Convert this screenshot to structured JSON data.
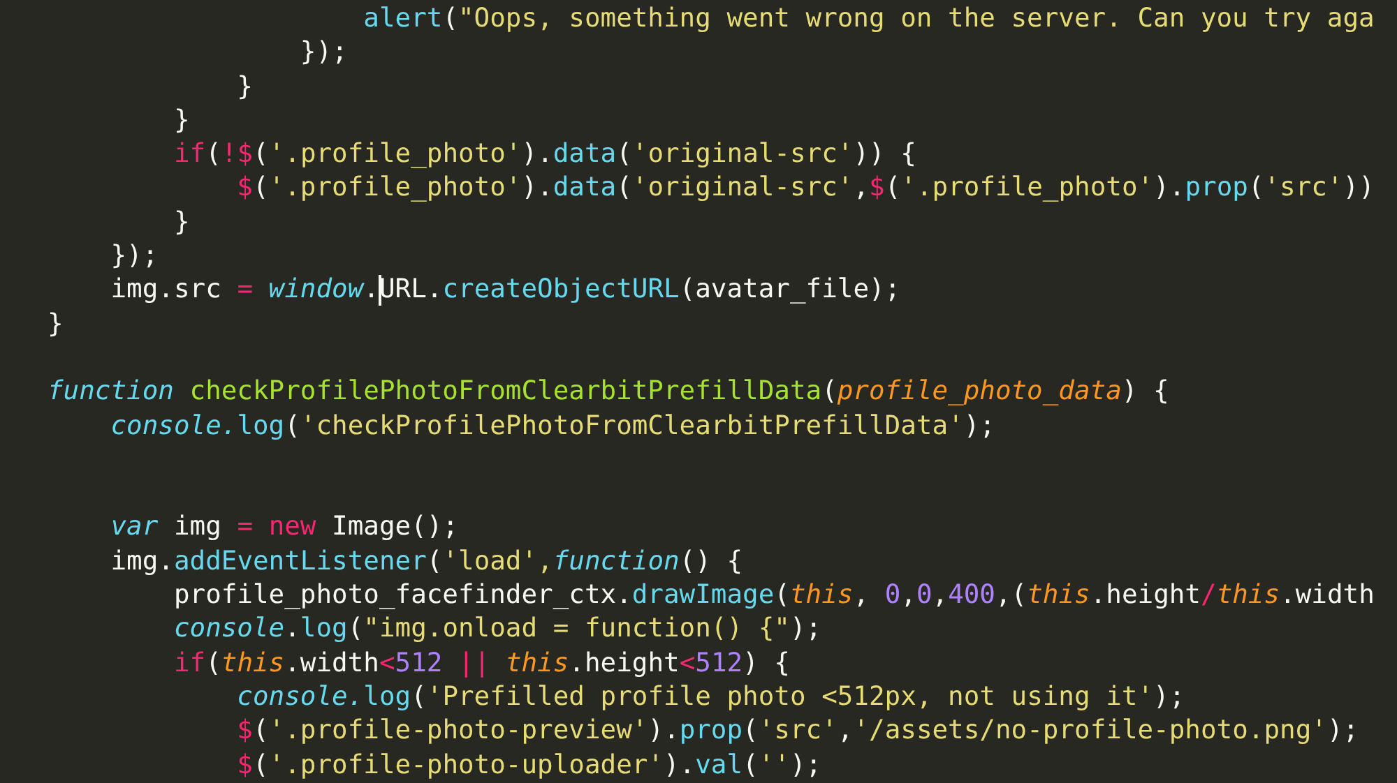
{
  "editor": {
    "lines": [
      {
        "kind": "code",
        "tokens": [
          {
            "kind": "fn",
            "text": "                    alert"
          },
          {
            "kind": "p",
            "text": "("
          },
          {
            "kind": "str",
            "text": "\"Oops, something went wrong on the server. Can you try aga"
          }
        ]
      },
      {
        "kind": "code",
        "tokens": [
          {
            "kind": "p",
            "text": "                });"
          }
        ]
      },
      {
        "kind": "code",
        "tokens": [
          {
            "kind": "p",
            "text": "            }"
          }
        ]
      },
      {
        "kind": "code",
        "tokens": [
          {
            "kind": "p",
            "text": "        }"
          }
        ]
      },
      {
        "kind": "code",
        "tokens": [
          {
            "kind": "kw",
            "text": "        if"
          },
          {
            "kind": "p",
            "text": "("
          },
          {
            "kind": "kw",
            "text": "!$"
          },
          {
            "kind": "p",
            "text": "("
          },
          {
            "kind": "str",
            "text": "'.profile_photo'"
          },
          {
            "kind": "p",
            "text": ")."
          },
          {
            "kind": "fn",
            "text": "data"
          },
          {
            "kind": "p",
            "text": "("
          },
          {
            "kind": "str",
            "text": "'original-src'"
          },
          {
            "kind": "p",
            "text": ")) {"
          }
        ]
      },
      {
        "kind": "code",
        "tokens": [
          {
            "kind": "kw",
            "text": "            $"
          },
          {
            "kind": "p",
            "text": "("
          },
          {
            "kind": "str",
            "text": "'.profile_photo'"
          },
          {
            "kind": "p",
            "text": ")."
          },
          {
            "kind": "fn",
            "text": "data"
          },
          {
            "kind": "p",
            "text": "("
          },
          {
            "kind": "str",
            "text": "'original-src'"
          },
          {
            "kind": "p",
            "text": ","
          },
          {
            "kind": "kw",
            "text": "$"
          },
          {
            "kind": "p",
            "text": "("
          },
          {
            "kind": "str",
            "text": "'.profile_photo'"
          },
          {
            "kind": "p",
            "text": ")."
          },
          {
            "kind": "fn",
            "text": "prop"
          },
          {
            "kind": "p",
            "text": "("
          },
          {
            "kind": "str",
            "text": "'src'"
          },
          {
            "kind": "p",
            "text": "))"
          }
        ]
      },
      {
        "kind": "code",
        "tokens": [
          {
            "kind": "p",
            "text": "        }"
          }
        ]
      },
      {
        "kind": "code",
        "tokens": [
          {
            "kind": "p",
            "text": "    });"
          }
        ]
      },
      {
        "kind": "code",
        "tokens": [
          {
            "kind": "p",
            "text": "    img.src "
          },
          {
            "kind": "kw",
            "text": "="
          },
          {
            "kind": "it",
            "text": " window"
          },
          {
            "kind": "p",
            "text": "."
          },
          {
            "kind": "p",
            "text": "URL",
            "caret": true
          },
          {
            "kind": "p",
            "text": "."
          },
          {
            "kind": "fn",
            "text": "createObjectURL"
          },
          {
            "kind": "p",
            "text": "(avatar_file);"
          }
        ]
      },
      {
        "kind": "code",
        "tokens": [
          {
            "kind": "p",
            "text": "}"
          }
        ]
      },
      {
        "kind": "blank"
      },
      {
        "kind": "code",
        "tokens": [
          {
            "kind": "it",
            "text": "function "
          },
          {
            "kind": "def",
            "text": "checkProfilePhotoFromClearbitPrefillData"
          },
          {
            "kind": "p",
            "text": "("
          },
          {
            "kind": "param",
            "text": "profile_photo_data"
          },
          {
            "kind": "p",
            "text": ") {"
          }
        ]
      },
      {
        "kind": "code",
        "tokens": [
          {
            "kind": "it",
            "text": "    console."
          },
          {
            "kind": "fn",
            "text": "log"
          },
          {
            "kind": "p",
            "text": "("
          },
          {
            "kind": "str",
            "text": "'checkProfilePhotoFromClearbitPrefillData'"
          },
          {
            "kind": "p",
            "text": ");"
          }
        ]
      },
      {
        "kind": "blank"
      },
      {
        "kind": "blank"
      },
      {
        "kind": "code",
        "tokens": [
          {
            "kind": "it",
            "text": "    var"
          },
          {
            "kind": "p",
            "text": " img "
          },
          {
            "kind": "kw",
            "text": "="
          },
          {
            "kind": "kw",
            "text": " new"
          },
          {
            "kind": "p",
            "text": " Image();"
          }
        ]
      },
      {
        "kind": "code",
        "tokens": [
          {
            "kind": "p",
            "text": "    img."
          },
          {
            "kind": "fn",
            "text": "addEventListener"
          },
          {
            "kind": "p",
            "text": "("
          },
          {
            "kind": "str",
            "text": "'load',"
          },
          {
            "kind": "it",
            "text": "function"
          },
          {
            "kind": "p",
            "text": "() {"
          }
        ]
      },
      {
        "kind": "code",
        "tokens": [
          {
            "kind": "p",
            "text": "        profile_photo_facefinder_ctx."
          },
          {
            "kind": "fn",
            "text": "drawImage"
          },
          {
            "kind": "p",
            "text": "("
          },
          {
            "kind": "param",
            "text": "this"
          },
          {
            "kind": "p",
            "text": ", "
          },
          {
            "kind": "num",
            "text": "0"
          },
          {
            "kind": "p",
            "text": ","
          },
          {
            "kind": "num",
            "text": "0"
          },
          {
            "kind": "p",
            "text": ","
          },
          {
            "kind": "num",
            "text": "400"
          },
          {
            "kind": "p",
            "text": ",("
          },
          {
            "kind": "param",
            "text": "this"
          },
          {
            "kind": "p",
            "text": ".height"
          },
          {
            "kind": "kw",
            "text": "/"
          },
          {
            "kind": "param",
            "text": "this"
          },
          {
            "kind": "p",
            "text": ".width"
          }
        ]
      },
      {
        "kind": "code",
        "tokens": [
          {
            "kind": "it",
            "text": "        console"
          },
          {
            "kind": "p",
            "text": "."
          },
          {
            "kind": "fn",
            "text": "log"
          },
          {
            "kind": "p",
            "text": "("
          },
          {
            "kind": "str",
            "text": "\"img.onload = function() {\""
          },
          {
            "kind": "p",
            "text": ");"
          }
        ]
      },
      {
        "kind": "code",
        "tokens": [
          {
            "kind": "kw",
            "text": "        if"
          },
          {
            "kind": "p",
            "text": "("
          },
          {
            "kind": "param",
            "text": "this"
          },
          {
            "kind": "p",
            "text": ".width"
          },
          {
            "kind": "kw",
            "text": "<"
          },
          {
            "kind": "num",
            "text": "512"
          },
          {
            "kind": "kw",
            "text": " || "
          },
          {
            "kind": "param",
            "text": "this"
          },
          {
            "kind": "p",
            "text": ".height"
          },
          {
            "kind": "kw",
            "text": "<"
          },
          {
            "kind": "num",
            "text": "512"
          },
          {
            "kind": "p",
            "text": ") {"
          }
        ]
      },
      {
        "kind": "code",
        "tokens": [
          {
            "kind": "it",
            "text": "            console."
          },
          {
            "kind": "fn",
            "text": "log"
          },
          {
            "kind": "p",
            "text": "("
          },
          {
            "kind": "str",
            "text": "'Prefilled profile photo <512px, not using it'"
          },
          {
            "kind": "p",
            "text": ");"
          }
        ]
      },
      {
        "kind": "code",
        "tokens": [
          {
            "kind": "kw",
            "text": "            $"
          },
          {
            "kind": "p",
            "text": "("
          },
          {
            "kind": "str",
            "text": "'.profile-photo-preview'"
          },
          {
            "kind": "p",
            "text": ")."
          },
          {
            "kind": "fn",
            "text": "prop"
          },
          {
            "kind": "p",
            "text": "("
          },
          {
            "kind": "str",
            "text": "'src'"
          },
          {
            "kind": "p",
            "text": ","
          },
          {
            "kind": "str",
            "text": "'/assets/no-profile-photo.png'"
          },
          {
            "kind": "p",
            "text": ");"
          }
        ]
      },
      {
        "kind": "code",
        "tokens": [
          {
            "kind": "kw",
            "text": "            $"
          },
          {
            "kind": "p",
            "text": "("
          },
          {
            "kind": "str",
            "text": "'.profile-photo-uploader'"
          },
          {
            "kind": "p",
            "text": ")."
          },
          {
            "kind": "fn",
            "text": "val"
          },
          {
            "kind": "p",
            "text": "("
          },
          {
            "kind": "str",
            "text": "''"
          },
          {
            "kind": "p",
            "text": ");"
          }
        ]
      }
    ]
  }
}
